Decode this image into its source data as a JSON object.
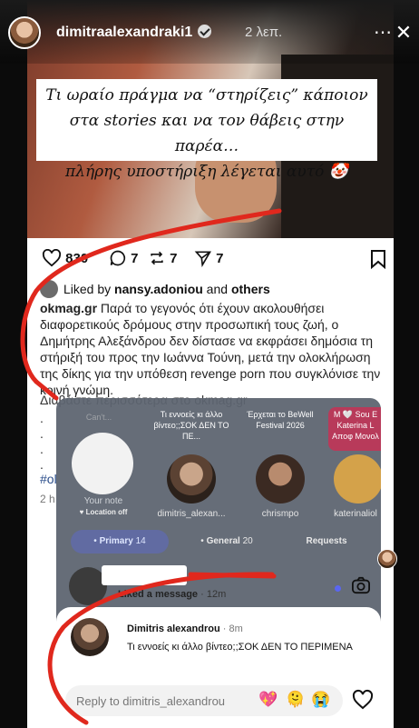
{
  "story": {
    "username": "dimitraalexandraki1",
    "time": "2 λεπ.",
    "more": "⋯",
    "close": "✕"
  },
  "post": {
    "overlay_lines": [
      "Τι ωραίο πράγμα να “στηρίζεις” κάποιον",
      "στα stories και να τον θάβεις στην παρέα…",
      "πλήρης υποστήριξη λέγεται αυτό 🤡"
    ],
    "likes": "830",
    "comments": "7",
    "reposts": "7",
    "shares": "7",
    "liked_by_prefix": "Liked by ",
    "liked_by_user": "nansy.adoniou",
    "liked_by_and": " and ",
    "liked_by_others": "others",
    "caption_user": "okmag.gr",
    "caption_text": " Παρά το γεγονός ότι έχουν ακολουθήσει διαφορετικούς δρόμους στην προσωπική τους ζωή, ο Δημήτρης Αλεξάνδρου δεν δίστασε να εκφράσει δημόσια τη στήριξή του προς την Ιωάννα Τούνη, μετά την ολοκλήρωση της δίκης για την υπόθεση revenge porn που συγκλόνισε την κοινή γνώμη.",
    "more_line": "Διαβάστε περισσότερα στο okmag.gr",
    "dots": ".\n.\n.\n.",
    "hashtag_fragment": "#ol",
    "time_fragment": "2 h"
  },
  "share_sheet": {
    "note_prompt": "Can't...",
    "note_label": "Your note",
    "note_location": "♥ Location off",
    "contacts": [
      {
        "bubble": "Τι εννοείς κι άλλο βίντεο;;ΣΟΚ ΔΕΝ ΤΟ ΠΕ...",
        "name": "dimitris_alexan..."
      },
      {
        "bubble": "Έρχεται το BeWell Festival 2026",
        "name": "chrismpo"
      },
      {
        "bubble": "M 🤍 Sou E Katerina L Αποφ Μονολ",
        "name": "katerinaliol"
      }
    ],
    "tabs": {
      "primary_label": "Primary",
      "primary_count": "14",
      "general_label": "General",
      "general_count": "20",
      "requests_label": "Requests"
    },
    "dm_status": "Liked a message",
    "dm_time": " · 12m"
  },
  "reply": {
    "name": "Dimitris alexandrou",
    "time": " · 8m",
    "message": "Τι εννοείς κι άλλο βίντεο;;ΣΟΚ ΔΕΝ ΤΟ ΠΕΡΙΜΕΝΑ",
    "placeholder": "Reply to dimitris_alexandrou",
    "emojis": [
      "💖",
      "🫠",
      "😭"
    ]
  },
  "colors": {
    "arrow": "#e0281d",
    "accent": "#5a66f0",
    "link": "#2a4d8a"
  }
}
